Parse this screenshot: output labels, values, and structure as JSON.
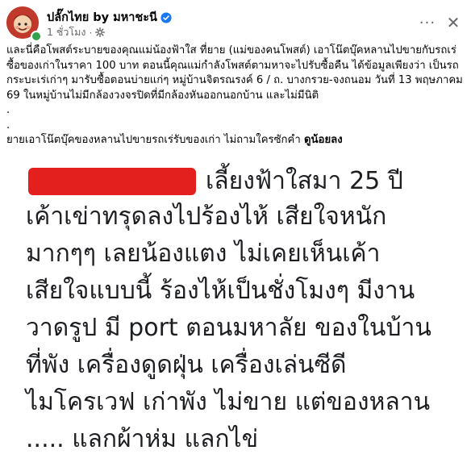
{
  "post": {
    "author": "ปลั๊กไทย by มหาชะนี",
    "time": "1 ชั่วโมง",
    "separator": "·",
    "more_label": "···",
    "close_label": "✕"
  },
  "body": {
    "para1": "และนี่คือโพสต์ระบายของคุณแม่น้องฟ้าใส ที่ยาย (แม่ของคนโพสต์) เอาโน๊ตบุ๊คหลานไปขายกับรถเร่ซื้อของเก่าในราคา 100 บาท ตอนนี้คุณแม่กำลังโพสต์ตามหาจะไปรับซื้อคืน ได้ข้อมูลเพียงว่า เป็นรถกระบะเร่เก่าๆ มารับซื้อตอนบ่ายแก่ๆ หมู่บ้านจิตรณรงค์ 6 / ถ. บางกรวย-จงถนอม วันที่ 13 พฤษภาคม 69 ในหมู่บ้านไม่มีกล้องวงจรปิดที่มีกล้องหันออกนอกบ้าน และไม่มีนิติ",
    "dot1": ".",
    "dot2": ".",
    "para2_prefix": "ยายเอาโน๊ตบุ๊คของหลานไปขายรถเร่รับของเก่า ไม่ถามใครซักคำ ",
    "para2_bold": "ดูน้อยลง"
  },
  "image": {
    "lines": [
      "เลี้ยงฟ้าใสมา 25 ปี",
      "เค้าเข่าทรุดลงไปร้องไห้  เสียใจหนัก",
      "มากๆๆ เลยน้องแตง  ไม่เคยเห็นเค้า",
      "เสียใจแบบนี้  ร้องไห้เป็นชั่งโมงๆ มีงาน",
      "วาดรูป  มี port ตอนมหาลัย  ของในบ้าน",
      "ที่พัง  เครื่องดูดฝุ่น  เครื่องเล่นซีดี",
      "ไมโครเวฟ เก่าพัง  ไม่ขาย  แต่ของหลาน",
      "..... แลกผ้าห่ม แลกไข่"
    ]
  },
  "colors": {
    "verified": "#1877f2",
    "online": "#31a24c",
    "redaction": "#e4201f",
    "meta": "#65676b"
  },
  "icons": {
    "verified": "verified-badge-icon",
    "privacy": "gear-icon",
    "avatar": "avatar-icon"
  }
}
